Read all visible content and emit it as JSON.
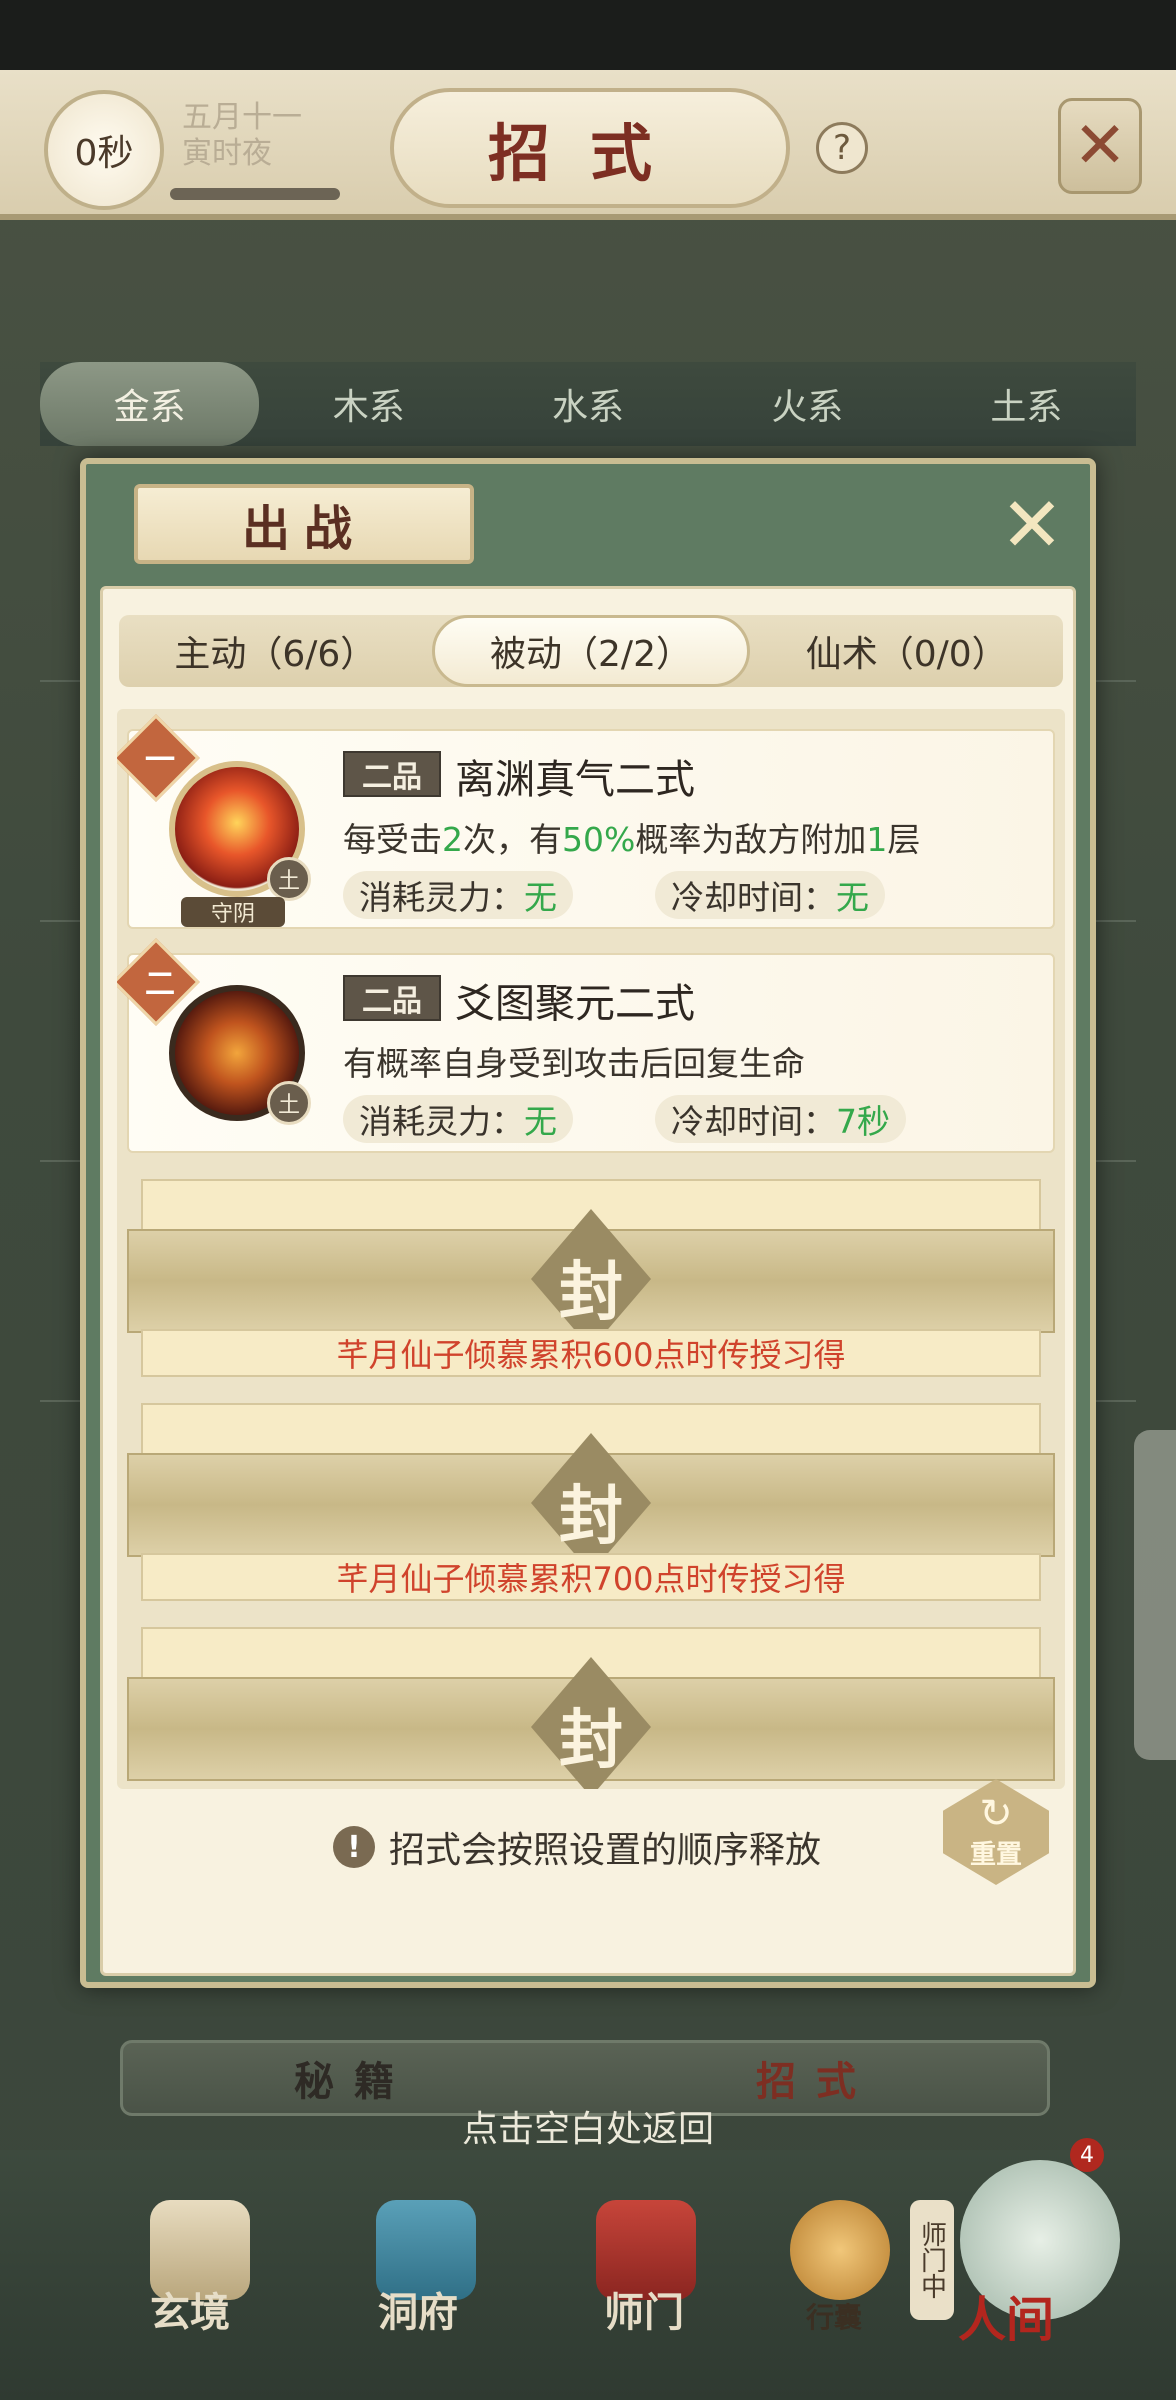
{
  "header": {
    "timer": "0秒",
    "date_line1": "五月十一",
    "date_line2": "寅时夜",
    "title": "招式",
    "help_symbol": "?",
    "close_symbol": "✕"
  },
  "element_tabs": [
    "金系",
    "木系",
    "水系",
    "火系",
    "土系"
  ],
  "modal": {
    "title": "出战",
    "close_symbol": "✕",
    "sub_tabs": [
      {
        "label": "主动（6/6）",
        "active": false
      },
      {
        "label": "被动（2/2）",
        "active": true
      },
      {
        "label": "仙术（0/0）",
        "active": false
      }
    ],
    "skills": [
      {
        "rank": "一",
        "grade": "二品",
        "name": "离渊真气二式",
        "desc_parts": [
          "每受击",
          "2",
          "次，有",
          "50%",
          "概率为敌方附加",
          "1",
          "层"
        ],
        "element": "土",
        "tag": "守阴",
        "cost_label": "消耗灵力：",
        "cost_value": "无",
        "cooldown_label": "冷却时间：",
        "cooldown_value": "无",
        "icon": "flame-burst-icon"
      },
      {
        "rank": "二",
        "grade": "二品",
        "name": "爻图聚元二式",
        "desc": "有概率自身受到攻击后回复生命",
        "element": "土",
        "cost_label": "消耗灵力：",
        "cost_value": "无",
        "cooldown_label": "冷却时间：",
        "cooldown_value": "7秒",
        "icon": "cauldron-icon"
      }
    ],
    "sealed_slots": [
      {
        "char": "封",
        "hint": "芊月仙子倾慕累积600点时传授习得"
      },
      {
        "char": "封",
        "hint": "芊月仙子倾慕累积700点时传授习得"
      },
      {
        "char": "封",
        "hint": ""
      }
    ],
    "order_note": "招式会按照设置的顺序释放",
    "note_symbol": "!",
    "reset_label": "重置",
    "reset_symbol": "↻"
  },
  "bottom_tabs": [
    {
      "label": "秘籍",
      "active": false
    },
    {
      "label": "招式",
      "active": true
    }
  ],
  "return_hint": "点击空白处返回",
  "nav": {
    "items": [
      "玄境",
      "洞府",
      "师门",
      "行囊",
      "人间"
    ],
    "master_tag": "师门中",
    "badge_count": "4"
  },
  "colors": {
    "accent_red": "#d0432c",
    "value_green": "#34a84b",
    "panel_green": "#5f7b62",
    "parchment": "#f8f2e0"
  }
}
